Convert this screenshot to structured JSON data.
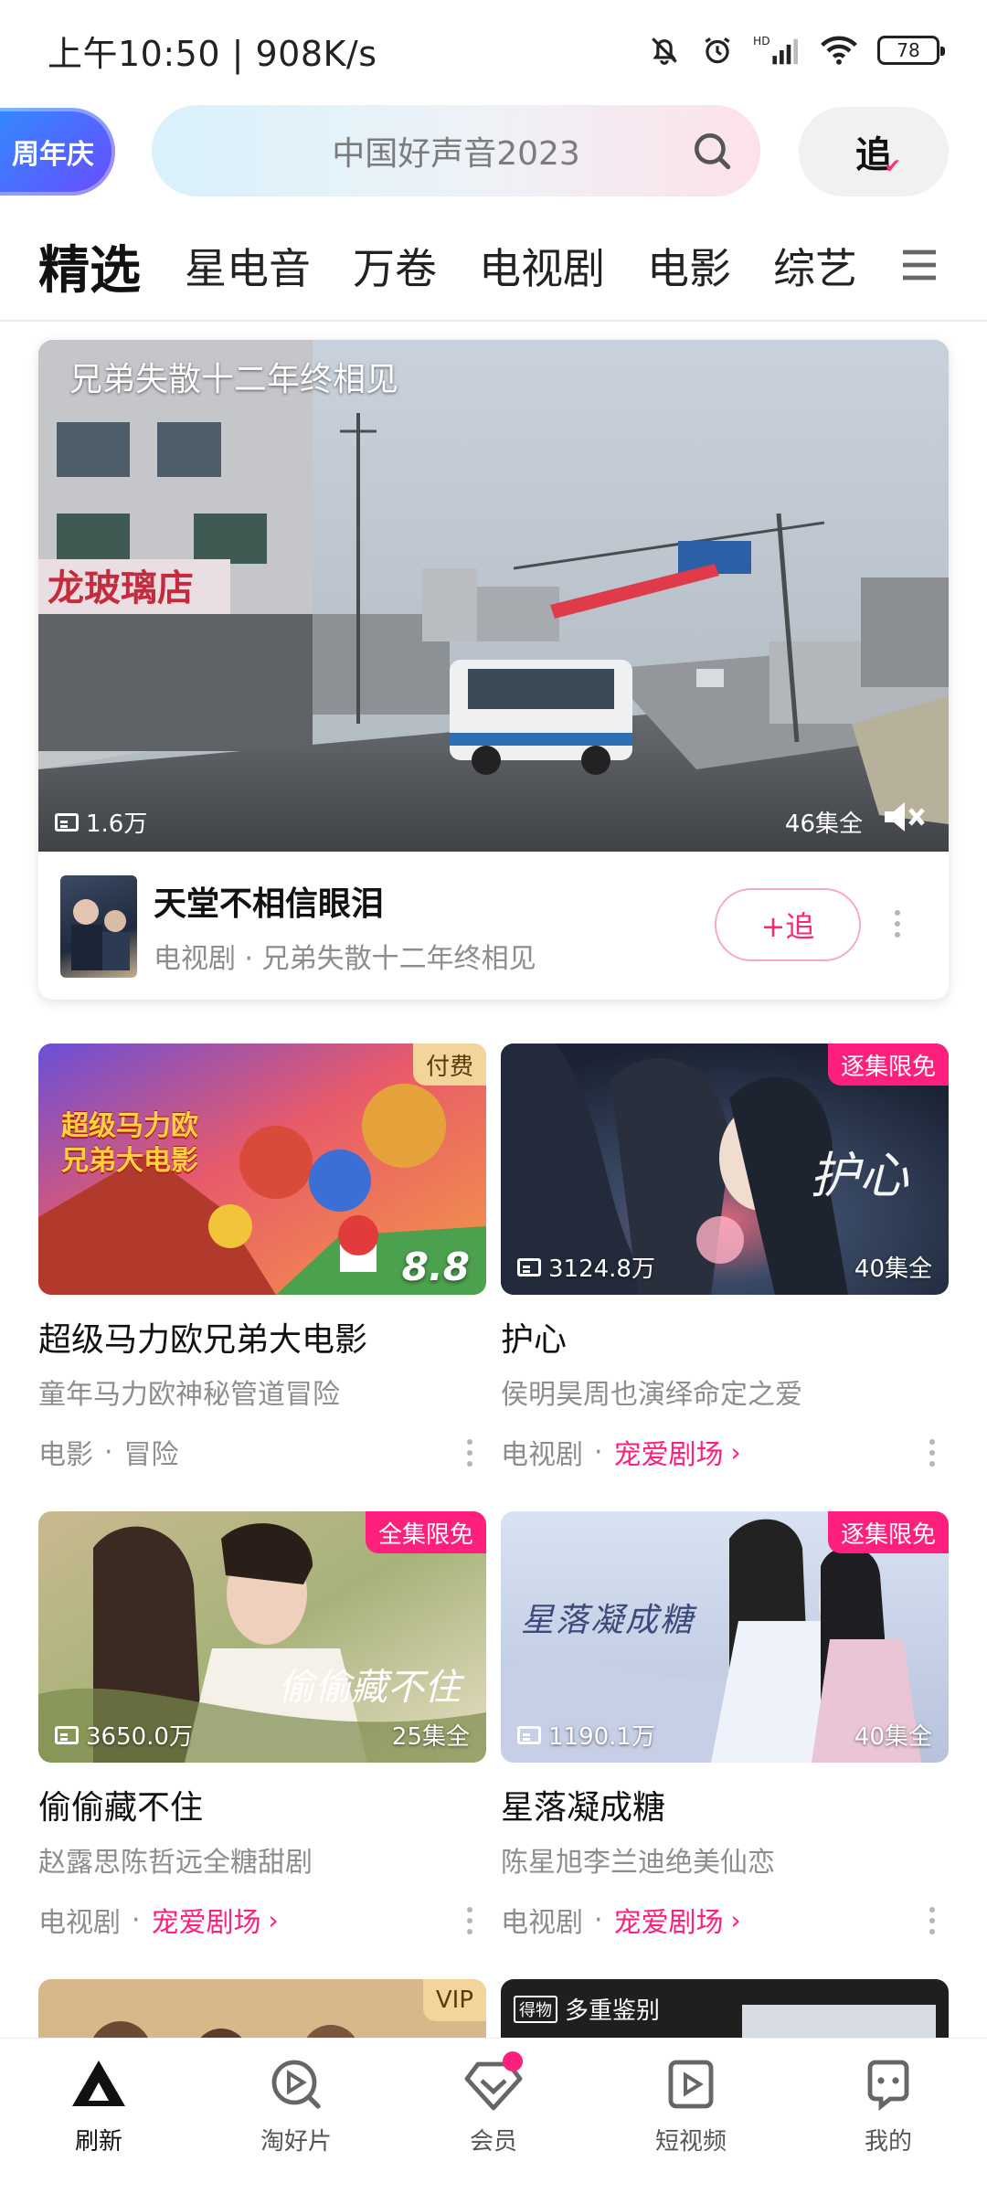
{
  "status_bar": {
    "time": "上午10:50 | 908K/s",
    "battery": "78",
    "icons": [
      "bell-off-icon",
      "alarm-icon",
      "hd-signal-icon",
      "wifi-icon",
      "battery-icon"
    ]
  },
  "header": {
    "anniversary_badge": "周年庆",
    "search_placeholder": "中国好声音2023",
    "follow_label": "追"
  },
  "tabs": [
    "精选",
    "星电音",
    "万卷",
    "电视剧",
    "电影",
    "综艺"
  ],
  "featured": {
    "caption": "兄弟失散十二年终相见",
    "views": "1.6万",
    "episodes": "46集全",
    "title": "天堂不相信眼泪",
    "subtitle": "电视剧 · 兄弟失散十二年终相见",
    "follow_button": "+追"
  },
  "cards": [
    {
      "tag": "付费",
      "score": "8.8",
      "title": "超级马力欧兄弟大电影",
      "desc": "童年马力欧神秘管道冒险",
      "category": "电影",
      "genre": "冒险",
      "poster_text": "超级马力欧兄弟大电影"
    },
    {
      "tag": "逐集限免",
      "views": "3124.8万",
      "episodes": "40集全",
      "title": "护心",
      "desc": "侯明昊周也演绎命定之爱",
      "category": "电视剧",
      "link": "宠爱剧场",
      "poster_text": "护心"
    },
    {
      "tag": "全集限免",
      "views": "3650.0万",
      "episodes": "25集全",
      "title": "偷偷藏不住",
      "desc": "赵露思陈哲远全糖甜剧",
      "category": "电视剧",
      "link": "宠爱剧场",
      "poster_text": "偷偷藏不住"
    },
    {
      "tag": "逐集限免",
      "views": "1190.1万",
      "episodes": "40集全",
      "title": "星落凝成糖",
      "desc": "陈星旭李兰迪绝美仙恋",
      "category": "电视剧",
      "link": "宠爱剧场",
      "poster_text": "星落凝成糖"
    },
    {
      "tag": "VIP"
    },
    {
      "overlay_label": "多重鉴别",
      "overlay_badge": "得物"
    }
  ],
  "bottom_nav": [
    {
      "label": "刷新",
      "icon": "refresh-logo-icon"
    },
    {
      "label": "淘好片",
      "icon": "discover-play-icon"
    },
    {
      "label": "会员",
      "icon": "vip-diamond-icon"
    },
    {
      "label": "短视频",
      "icon": "short-video-icon"
    },
    {
      "label": "我的",
      "icon": "profile-chat-icon"
    }
  ],
  "colors": {
    "accent_pink": "#ff1f7d",
    "badge_blue": "#2f8cff",
    "tag_gold": "#f3d49a"
  }
}
